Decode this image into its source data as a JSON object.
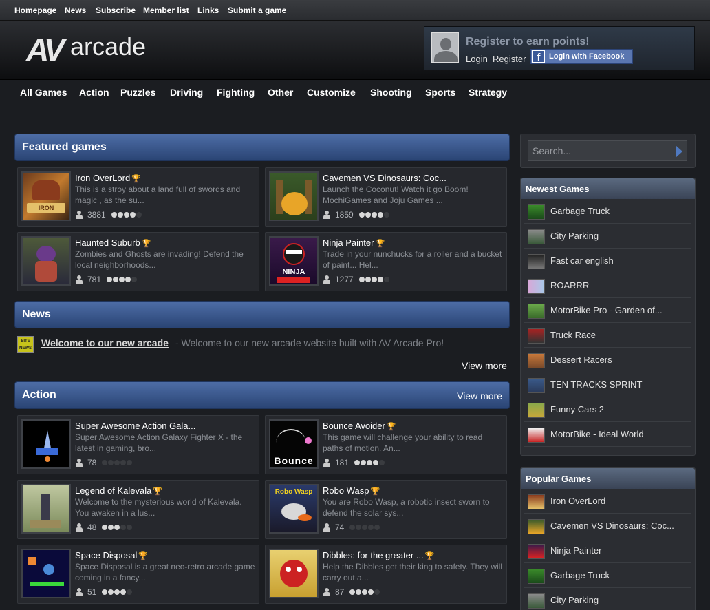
{
  "topnav": [
    "Homepage",
    "News",
    "Subscribe",
    "Member list",
    "Links",
    "Submit a game"
  ],
  "logo": {
    "av": "AV",
    "text": "arcade"
  },
  "register_box": {
    "title": "Register to earn points!",
    "login": "Login",
    "register": "Register",
    "facebook": "Login with Facebook"
  },
  "categories": [
    "All Games",
    "Action",
    "Puzzles",
    "Driving",
    "Fighting",
    "Other",
    "Customize",
    "Shooting",
    "Sports",
    "Strategy"
  ],
  "featured": {
    "title": "Featured games",
    "games": [
      {
        "name": "Iron OverLord",
        "desc": "This is a stroy about a land full of swords and magic , as the su...",
        "plays": "3881",
        "rating": 4,
        "trophy": true
      },
      {
        "name": "Cavemen VS Dinosaurs: Coc...",
        "desc": "Launch the Coconut! Watch it go Boom! MochiGames and Joju Games ...",
        "plays": "1859",
        "rating": 4,
        "trophy": false
      },
      {
        "name": "Haunted Suburb",
        "desc": "Zombies and Ghosts are invading! Defend the local neighborhoods...",
        "plays": "781",
        "rating": 4,
        "trophy": true
      },
      {
        "name": "Ninja Painter",
        "desc": "Trade in your nunchucks for a roller and a bucket of paint... Hel...",
        "plays": "1277",
        "rating": 4,
        "trophy": true
      }
    ]
  },
  "news": {
    "title": "News",
    "item_title": "Welcome to our new arcade",
    "item_text": "- Welcome to our new arcade website built with AV Arcade Pro!",
    "icon_text": "SITE NEWS",
    "view_more": "View more"
  },
  "action": {
    "title": "Action",
    "view_more": "View more",
    "games": [
      {
        "name": "Super Awesome Action Gala...",
        "desc": "Super Awesome Action Galaxy Fighter X - the latest in gaming, bro...",
        "plays": "78",
        "rating": 0,
        "trophy": false
      },
      {
        "name": "Bounce Avoider",
        "desc": "This game will challenge your ability to read paths of motion. An...",
        "plays": "181",
        "rating": 4,
        "trophy": true
      },
      {
        "name": "Legend of Kalevala",
        "desc": "Welcome to the mysterious world of Kalevala. You awaken in a lus...",
        "plays": "48",
        "rating": 3,
        "trophy": true
      },
      {
        "name": "Robo Wasp",
        "desc": "You are Robo Wasp, a robotic insect sworn to defend the solar sys...",
        "plays": "74",
        "rating": 0,
        "trophy": true
      },
      {
        "name": "Space Disposal",
        "desc": "Space Disposal is a great neo-retro arcade game coming in a fancy...",
        "plays": "51",
        "rating": 4,
        "trophy": true
      },
      {
        "name": "Dibbles: for the greater ...",
        "desc": "Help the Dibbles get their king to safety. They will carry out a...",
        "plays": "87",
        "rating": 4,
        "trophy": true
      }
    ]
  },
  "thumb_text": {
    "bounce": "Bounce",
    "ninja": "NINJA",
    "robo": "Robo Wasp",
    "iron": "IRON"
  },
  "search": {
    "placeholder": "Search..."
  },
  "newest": {
    "title": "Newest Games",
    "items": [
      "Garbage Truck",
      "City Parking",
      "Fast car english",
      "ROARRR",
      "MotorBike Pro - Garden of...",
      "Truck Race",
      "Dessert Racers",
      "TEN TRACKS SPRINT",
      "Funny Cars 2",
      "MotorBike - Ideal World"
    ]
  },
  "popular": {
    "title": "Popular Games",
    "items": [
      "Iron OverLord",
      "Cavemen VS Dinosaurs: Coc...",
      "Ninja Painter",
      "Garbage Truck",
      "City Parking"
    ]
  },
  "colors": {
    "accent": "#3d5d95",
    "trophy": "#d9a922",
    "background": "#1b1d21"
  }
}
